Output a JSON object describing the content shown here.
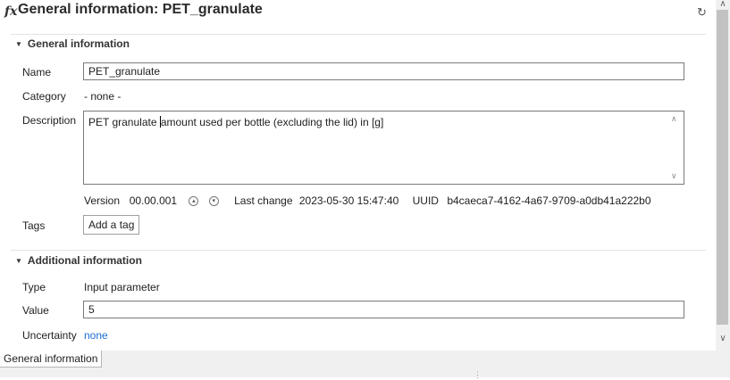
{
  "header": {
    "icon": "function-icon",
    "title": "General information: PET_granulate",
    "refresh_icon": "refresh-icon"
  },
  "general": {
    "section_title": "General information",
    "name_label": "Name",
    "name_value": "PET_granulate",
    "category_label": "Category",
    "category_value": "- none -",
    "description_label": "Description",
    "description_before_caret": "PET granulate ",
    "description_after_caret": "amount used per bottle (excluding the lid) in [g]",
    "version_label": "Version",
    "version_value": "00.00.001",
    "last_change_label": "Last change",
    "last_change_value": "2023-05-30 15:47:40",
    "uuid_label": "UUID",
    "uuid_value": "b4caeca7-4162-4a67-9709-a0db41a222b0",
    "tags_label": "Tags",
    "add_tag_label": "Add a tag"
  },
  "additional": {
    "section_title": "Additional information",
    "type_label": "Type",
    "type_value": "Input parameter",
    "value_label": "Value",
    "value_value": "5",
    "uncertainty_label": "Uncertainty",
    "uncertainty_value": "none"
  },
  "tabs": [
    {
      "label": "General information",
      "active": true
    }
  ]
}
